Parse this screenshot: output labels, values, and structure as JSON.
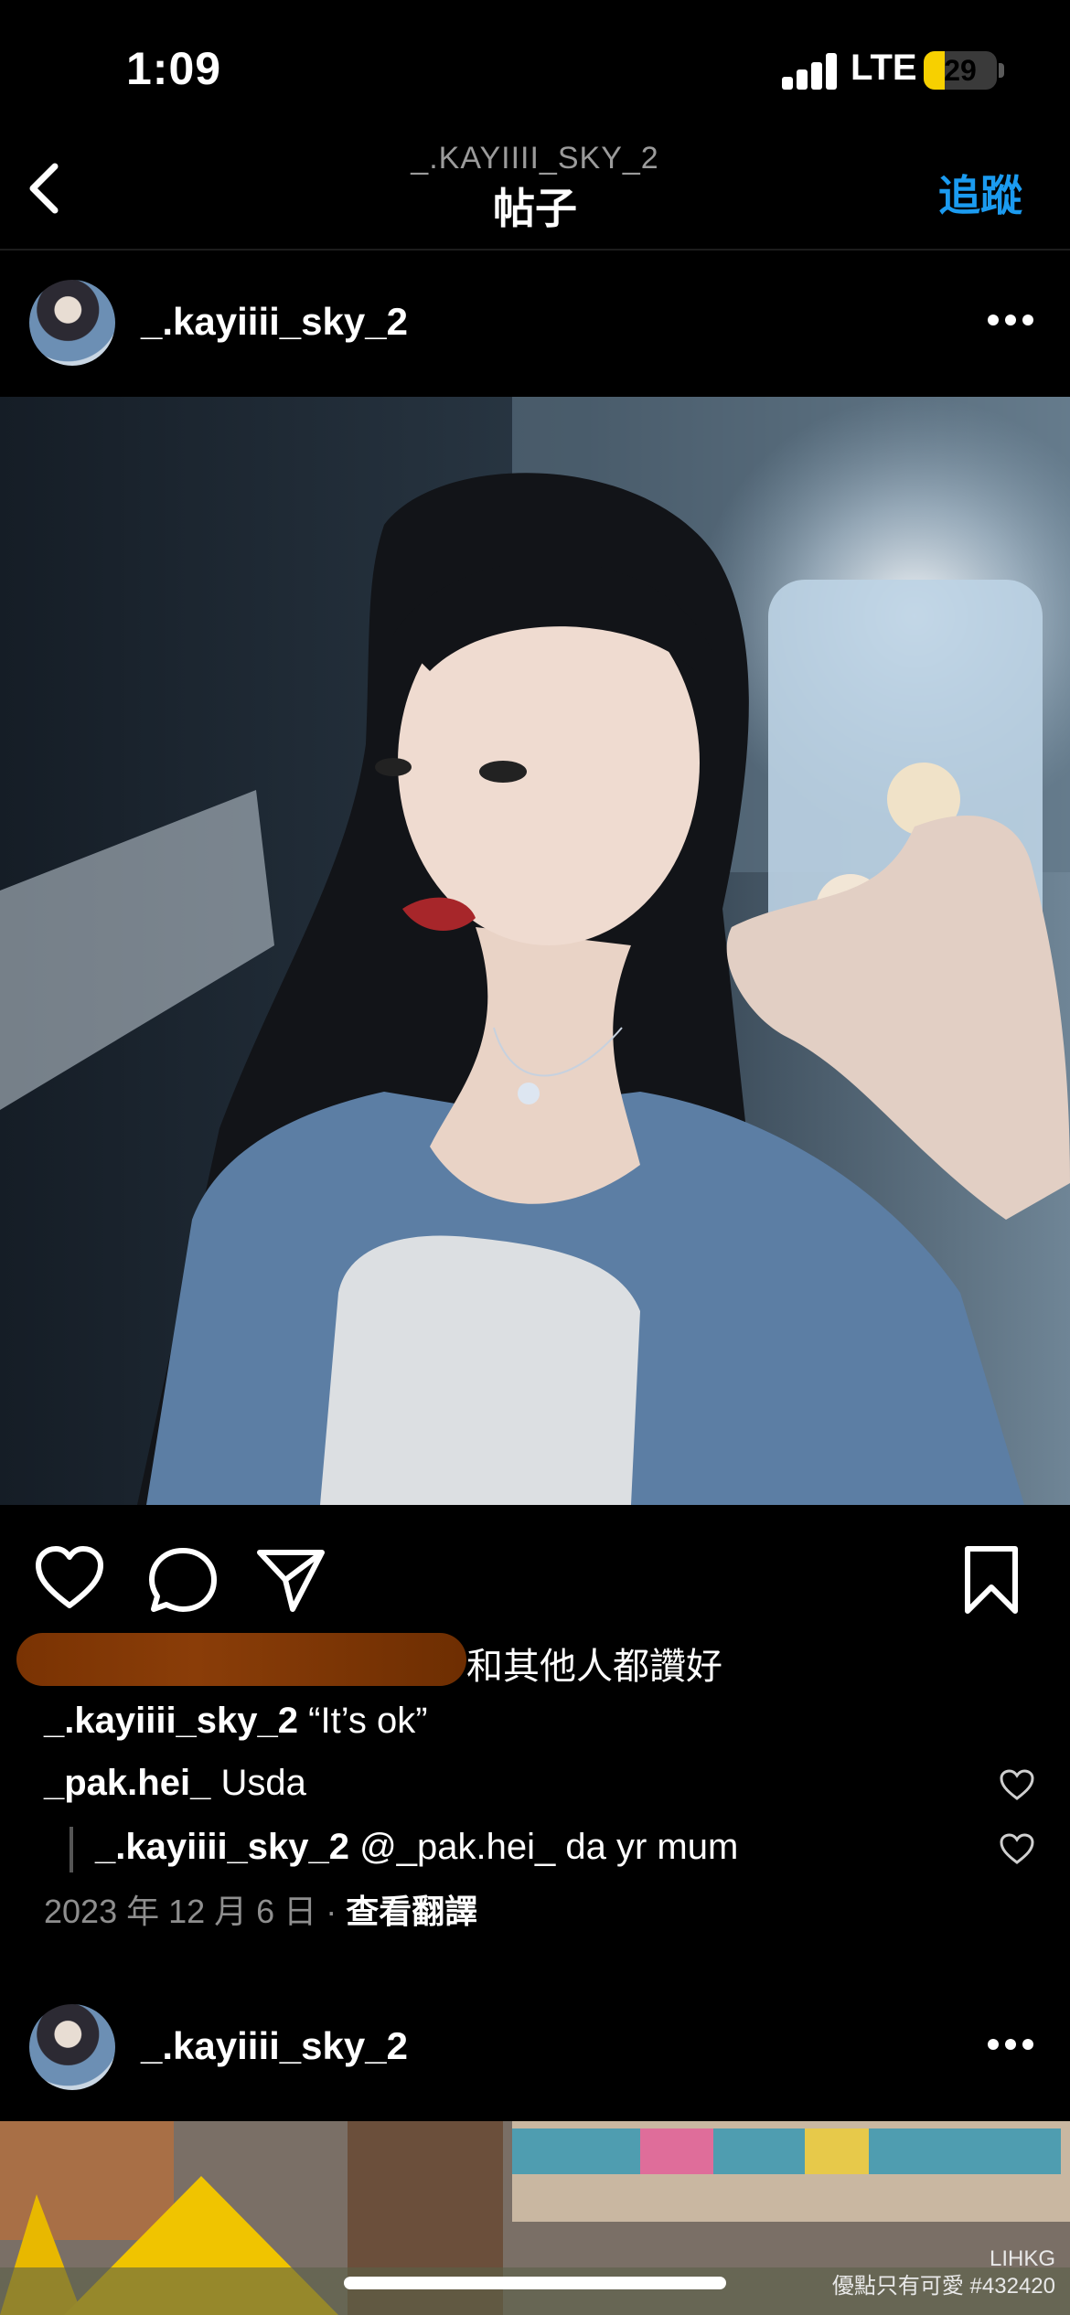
{
  "status_bar": {
    "time": "1:09",
    "network": "LTE",
    "battery": "29",
    "battery_fraction": 0.29
  },
  "header": {
    "subtitle": "_.KAYIIII_SKY_2",
    "title": "帖子",
    "follow_label": "追蹤"
  },
  "post": {
    "username": "_.kayiiii_sky_2",
    "likes_text": "和其他人都讚好",
    "caption_user": "_.kayiiii_sky_2",
    "caption_text": "“It’s ok”",
    "comments": [
      {
        "user": "_pak.hei_",
        "text": "Usda"
      },
      {
        "user": "_.kayiiii_sky_2",
        "text": "@_pak.hei_ da yr mum"
      }
    ],
    "date": "2023 年 12 月 6 日",
    "separator": "·",
    "translate_label": "查看翻譯"
  },
  "next_post": {
    "username": "_.kayiiii_sky_2"
  },
  "watermark": {
    "line1": "LIHKG",
    "line2": "優點只有可愛 #432420"
  },
  "icons": {
    "back": "chevron-left-icon",
    "more": "ellipsis-icon",
    "like": "heart-icon",
    "comment": "comment-bubble-icon",
    "share": "paper-plane-icon",
    "save": "bookmark-icon"
  },
  "colors": {
    "accent": "#1b9bf0",
    "background": "#000000",
    "battery": "#f7d000"
  }
}
